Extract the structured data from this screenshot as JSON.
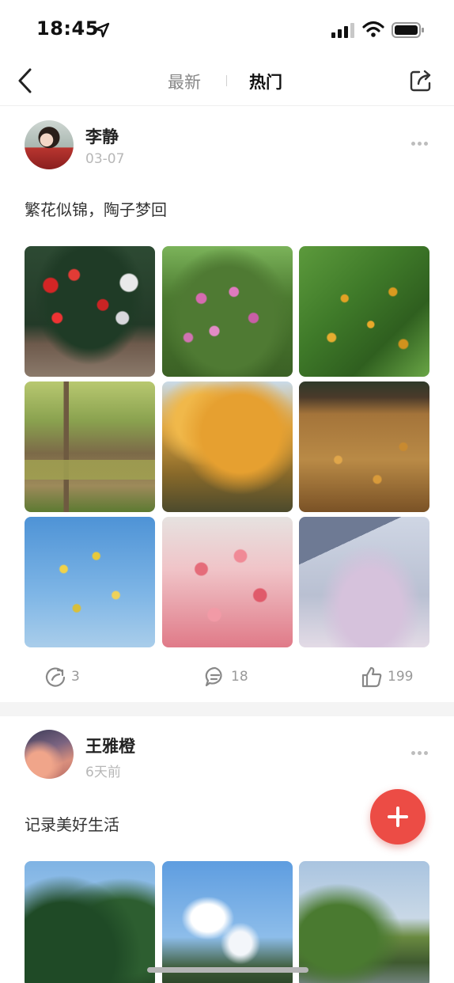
{
  "status_bar": {
    "time": "18:45"
  },
  "nav": {
    "tabs": [
      {
        "label": "最新",
        "active": false
      },
      {
        "label": "热门",
        "active": true
      }
    ]
  },
  "posts": [
    {
      "user": "李静",
      "time": "03-07",
      "text": "繁花似锦，陶子梦回",
      "photos": [
        "camellia",
        "climbing-roses",
        "osmanthus",
        "leafy-path",
        "ginkgo-tree",
        "fallen-leaves",
        "wintersweet",
        "plum-blossom",
        "cherry-blossom-building"
      ],
      "stats": {
        "shares": "3",
        "comments": "18",
        "likes": "199"
      }
    },
    {
      "user": "王雅橙",
      "time": "6天前",
      "text": "记录美好生活",
      "photos": [
        "pine-trees",
        "blue-sky-clouds",
        "lake-willows"
      ]
    }
  ],
  "colors": {
    "accent": "#ec4c45",
    "muted_text": "#b7b7b7",
    "stat_text": "#999999"
  },
  "icons": [
    "back-icon",
    "share-icon",
    "more-icon",
    "repost-icon",
    "comment-icon",
    "like-icon",
    "plus-icon"
  ]
}
